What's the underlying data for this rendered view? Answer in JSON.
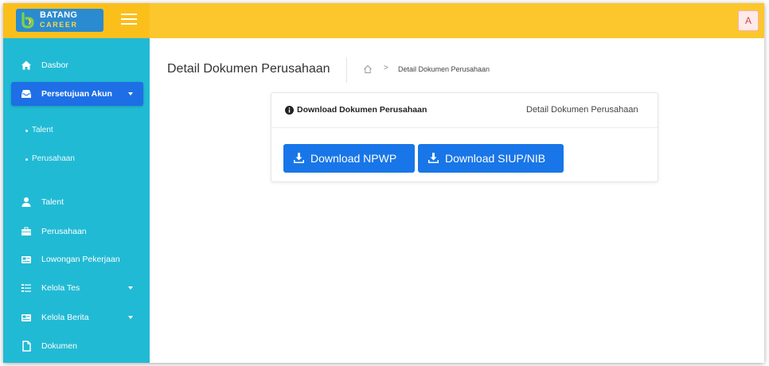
{
  "brand": {
    "line1": "BATANG",
    "line2": "CAREER",
    "colors": {
      "topbar": "#fcc72d",
      "sidebar": "#21bad4",
      "active": "#1e6fe6",
      "button": "#1976e8"
    }
  },
  "header": {
    "avatar_letter": "A"
  },
  "sidebar": {
    "items": [
      {
        "label": "Dasbor",
        "icon": "home-icon"
      },
      {
        "label": "Persetujuan Akun",
        "icon": "inbox-icon",
        "active": true,
        "expanded": true
      },
      {
        "label": "Talent",
        "icon": "user-icon"
      },
      {
        "label": "Perusahaan",
        "icon": "briefcase-icon"
      },
      {
        "label": "Lowongan Pekerjaan",
        "icon": "newspaper-icon"
      },
      {
        "label": "Kelola Tes",
        "icon": "list-check-icon"
      },
      {
        "label": "Kelola Berita",
        "icon": "newspaper-icon"
      },
      {
        "label": "Dokumen",
        "icon": "file-icon"
      }
    ],
    "subitems": [
      {
        "label": "Talent"
      },
      {
        "label": "Perusahaan"
      }
    ]
  },
  "main": {
    "title": "Detail Dokumen Perusahaan",
    "breadcrumb": {
      "separator": ">",
      "current": "Detail Dokumen Perusahaan"
    },
    "card": {
      "title": "Download Dokumen Perusahaan",
      "subtitle": "Detail Dokumen Perusahaan",
      "buttons": [
        {
          "label": "Download NPWP",
          "icon": "download-icon"
        },
        {
          "label": "Download SIUP/NIB",
          "icon": "download-icon"
        }
      ]
    }
  }
}
